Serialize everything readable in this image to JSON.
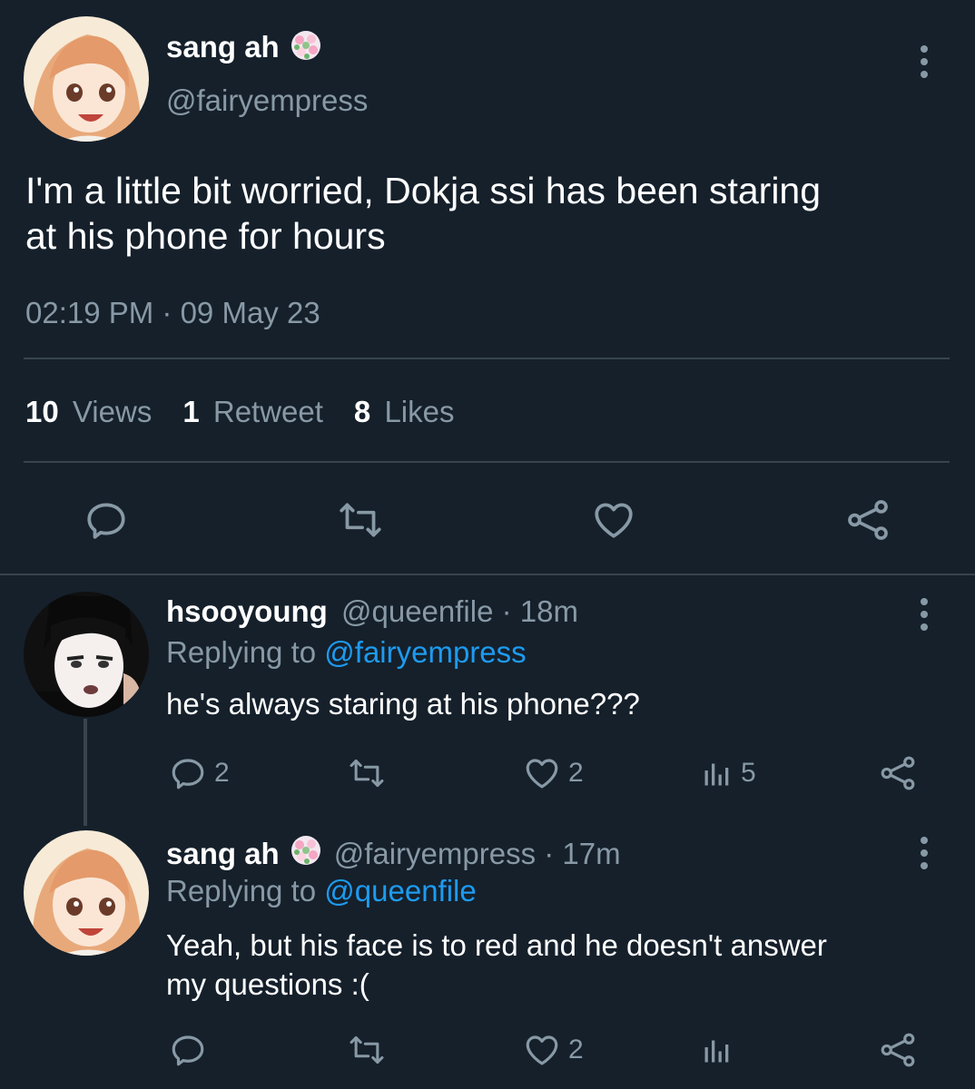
{
  "main_tweet": {
    "author_name": "sang ah",
    "handle": "@fairyempress",
    "text_line1": "I'm a little bit worried, Dokja ssi has been staring",
    "text_line2": "at his phone for hours",
    "timestamp": "02:19 PM · 09 May 23",
    "stats": {
      "views_count": "10",
      "views_label": "Views",
      "retweets_count": "1",
      "retweets_label": "Retweet",
      "likes_count": "8",
      "likes_label": "Likes"
    }
  },
  "replies": [
    {
      "author_name": "hsooyoung",
      "meta": "@queenfile · 18m",
      "replying_prefix": "Replying to",
      "replying_to": "@fairyempress",
      "text_line1": "he's always staring at his phone???",
      "text_line2": "",
      "reply_count": "2",
      "retweet_count": "",
      "like_count": "2",
      "views_count": "5"
    },
    {
      "author_name": "sang ah",
      "meta": "@fairyempress · 17m",
      "replying_prefix": "Replying to",
      "replying_to": "@queenfile",
      "text_line1": "Yeah, but his face is to red and he doesn't answer",
      "text_line2": "my questions :(",
      "reply_count": "",
      "retweet_count": "",
      "like_count": "2",
      "views_count": ""
    }
  ],
  "colors": {
    "background": "#15202b",
    "muted_text": "#8899a6",
    "link": "#1d9bf0",
    "divider": "#38444d"
  },
  "icons": [
    "flower-emoji-icon",
    "more-options-icon",
    "reply-icon",
    "retweet-icon",
    "like-icon",
    "views-icon",
    "share-icon"
  ]
}
